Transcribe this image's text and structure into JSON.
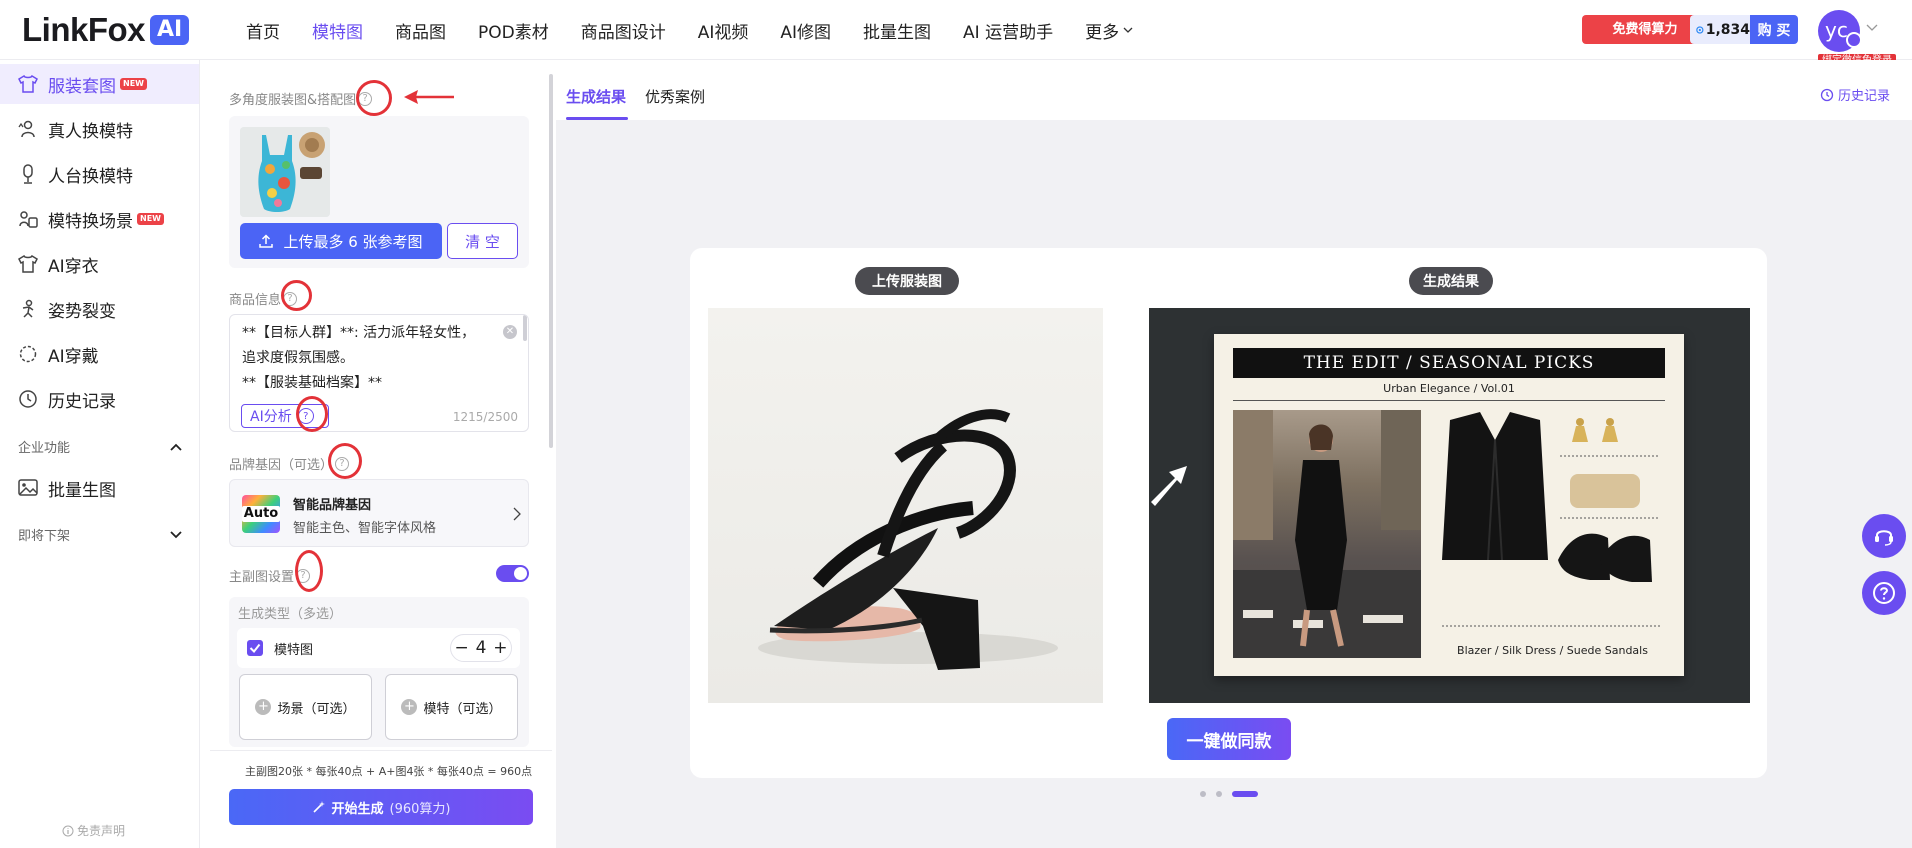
{
  "header": {
    "logo_text": "LinkFox",
    "logo_badge": "AI",
    "nav": [
      {
        "label": "首页",
        "active": false
      },
      {
        "label": "模特图",
        "active": true
      },
      {
        "label": "商品图",
        "active": false
      },
      {
        "label": "POD素材",
        "active": false
      },
      {
        "label": "商品图设计",
        "active": false
      },
      {
        "label": "AI视频",
        "active": false
      },
      {
        "label": "AI修图",
        "active": false
      },
      {
        "label": "批量生图",
        "active": false
      },
      {
        "label": "AI 运营助手",
        "active": false
      },
      {
        "label": "更多",
        "active": false
      }
    ],
    "free_compute_button": "免费得算力",
    "points": "1,834",
    "buy_label": "购 买",
    "avatar_text": "yc",
    "bind_tip": "绑定微信免登录"
  },
  "sidebar": {
    "items": [
      {
        "label": "服装套图",
        "icon": "shirt-icon",
        "badge": "NEW",
        "active": true
      },
      {
        "label": "真人换模特",
        "icon": "swap-person-icon",
        "badge": "",
        "active": false
      },
      {
        "label": "人台换模特",
        "icon": "mannequin-icon",
        "badge": "",
        "active": false
      },
      {
        "label": "模特换场景",
        "icon": "scene-swap-icon",
        "badge": "NEW",
        "active": false
      },
      {
        "label": "AI穿衣",
        "icon": "tshirt-icon",
        "badge": "",
        "active": false
      },
      {
        "label": "姿势裂变",
        "icon": "pose-icon",
        "badge": "",
        "active": false
      },
      {
        "label": "AI穿戴",
        "icon": "accessory-ring-icon",
        "badge": "",
        "active": false
      },
      {
        "label": "历史记录",
        "icon": "clock-icon",
        "badge": "",
        "active": false
      }
    ],
    "group_enterprise": "企业功能",
    "enterprise_items": [
      {
        "label": "批量生图",
        "icon": "image-icon"
      }
    ],
    "group_deprecated": "即将下架",
    "disclaimer": "免责声明"
  },
  "panel": {
    "section_images": "多角度服装图&搭配图",
    "upload_button": "上传最多 6 张参考图",
    "clear_button": "清 空",
    "section_product": "商品信息",
    "product_text_lines": [
      "**【目标人群】**: 活力派年轻女性，",
      "追求度假氛围感。",
      "**【服装基础档案】**"
    ],
    "ai_analyze": "AI分析",
    "char_count": "1215/2500",
    "section_brand": "品牌基因（可选）",
    "brand_tile": "Auto",
    "brand_title": "智能品牌基因",
    "brand_sub": "智能主色、智能字体风格",
    "section_main": "主副图设置",
    "main_toggle_on": true,
    "gen_type_label": "生成类型（多选）",
    "model_option": "模特图",
    "model_count": "4",
    "scene_button": "场景（可选）",
    "model_button": "模特（可选）",
    "formula": "主副图20张 * 每张40点 + A+图4张 * 每张40点 = 960点",
    "start_button": "开始生成",
    "start_cost": "(960算力)"
  },
  "main": {
    "tabs": [
      {
        "label": "生成结果",
        "active": true
      },
      {
        "label": "优秀案例",
        "active": false
      }
    ],
    "history_link": "历史记录",
    "upload_label": "上传服装图",
    "result_label": "生成结果",
    "poster_title": "THE EDIT / SEASONAL PICKS",
    "poster_subtitle": "Urban Elegance / Vol.01",
    "poster_caption": "Blazer / Silk Dress / Suede Sandals",
    "same_style_button": "一键做同款",
    "carousel_dots": 3,
    "carousel_active": 3
  },
  "colors": {
    "accent": "#6a4df0",
    "primary_blue": "#4b64f5",
    "danger": "#ec4247"
  }
}
